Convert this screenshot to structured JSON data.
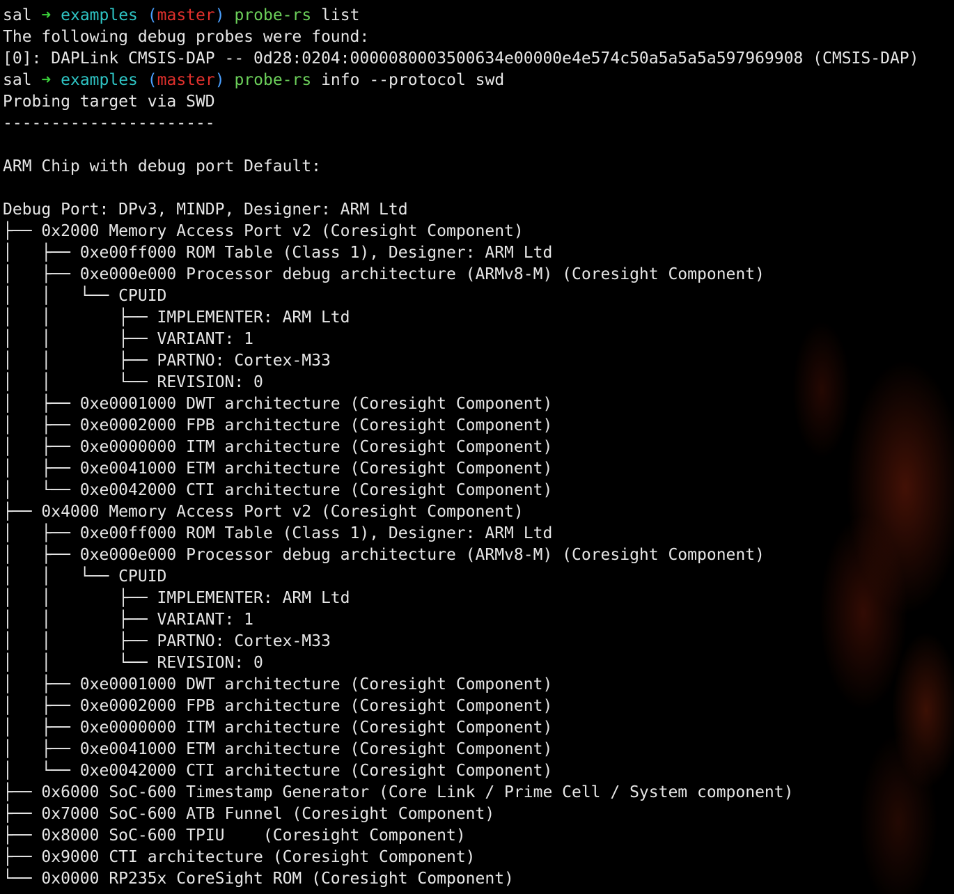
{
  "terminal": {
    "prompt": {
      "user": "sal",
      "arrow": "➜",
      "dir": "examples",
      "git_open": "(",
      "branch": "master",
      "git_close": ")"
    },
    "commands": [
      {
        "cmd": "probe-rs",
        "args": "list"
      },
      {
        "cmd": "probe-rs",
        "args": "info --protocol swd"
      }
    ],
    "output_list": [
      "The following debug probes were found:",
      "[0]: DAPLink CMSIS-DAP -- 0d28:0204:0000080003500634e00000e4e574c50a5a5a5a597969908 (CMSIS-DAP)"
    ],
    "output_info": [
      "Probing target via SWD",
      "----------------------",
      "",
      "ARM Chip with debug port Default:",
      "",
      "Debug Port: DPv3, MINDP, Designer: ARM Ltd",
      "├── 0x2000 Memory Access Port v2 (Coresight Component)",
      "│   ├── 0xe00ff000 ROM Table (Class 1), Designer: ARM Ltd",
      "│   ├── 0xe000e000 Processor debug architecture (ARMv8-M) (Coresight Component)",
      "│   │   └── CPUID",
      "│   │       ├── IMPLEMENTER: ARM Ltd",
      "│   │       ├── VARIANT: 1",
      "│   │       ├── PARTNO: Cortex-M33",
      "│   │       └── REVISION: 0",
      "│   ├── 0xe0001000 DWT architecture (Coresight Component)",
      "│   ├── 0xe0002000 FPB architecture (Coresight Component)",
      "│   ├── 0xe0000000 ITM architecture (Coresight Component)",
      "│   ├── 0xe0041000 ETM architecture (Coresight Component)",
      "│   └── 0xe0042000 CTI architecture (Coresight Component)",
      "├── 0x4000 Memory Access Port v2 (Coresight Component)",
      "│   ├── 0xe00ff000 ROM Table (Class 1), Designer: ARM Ltd",
      "│   ├── 0xe000e000 Processor debug architecture (ARMv8-M) (Coresight Component)",
      "│   │   └── CPUID",
      "│   │       ├── IMPLEMENTER: ARM Ltd",
      "│   │       ├── VARIANT: 1",
      "│   │       ├── PARTNO: Cortex-M33",
      "│   │       └── REVISION: 0",
      "│   ├── 0xe0001000 DWT architecture (Coresight Component)",
      "│   ├── 0xe0002000 FPB architecture (Coresight Component)",
      "│   ├── 0xe0000000 ITM architecture (Coresight Component)",
      "│   ├── 0xe0041000 ETM architecture (Coresight Component)",
      "│   └── 0xe0042000 CTI architecture (Coresight Component)",
      "├── 0x6000 SoC-600 Timestamp Generator (Core Link / Prime Cell / System component)",
      "├── 0x7000 SoC-600 ATB Funnel (Coresight Component)",
      "├── 0x8000 SoC-600 TPIU    (Coresight Component)",
      "├── 0x9000 CTI architecture (Coresight Component)",
      "└── 0x0000 RP235x CoreSight ROM (Coresight Component)"
    ]
  }
}
